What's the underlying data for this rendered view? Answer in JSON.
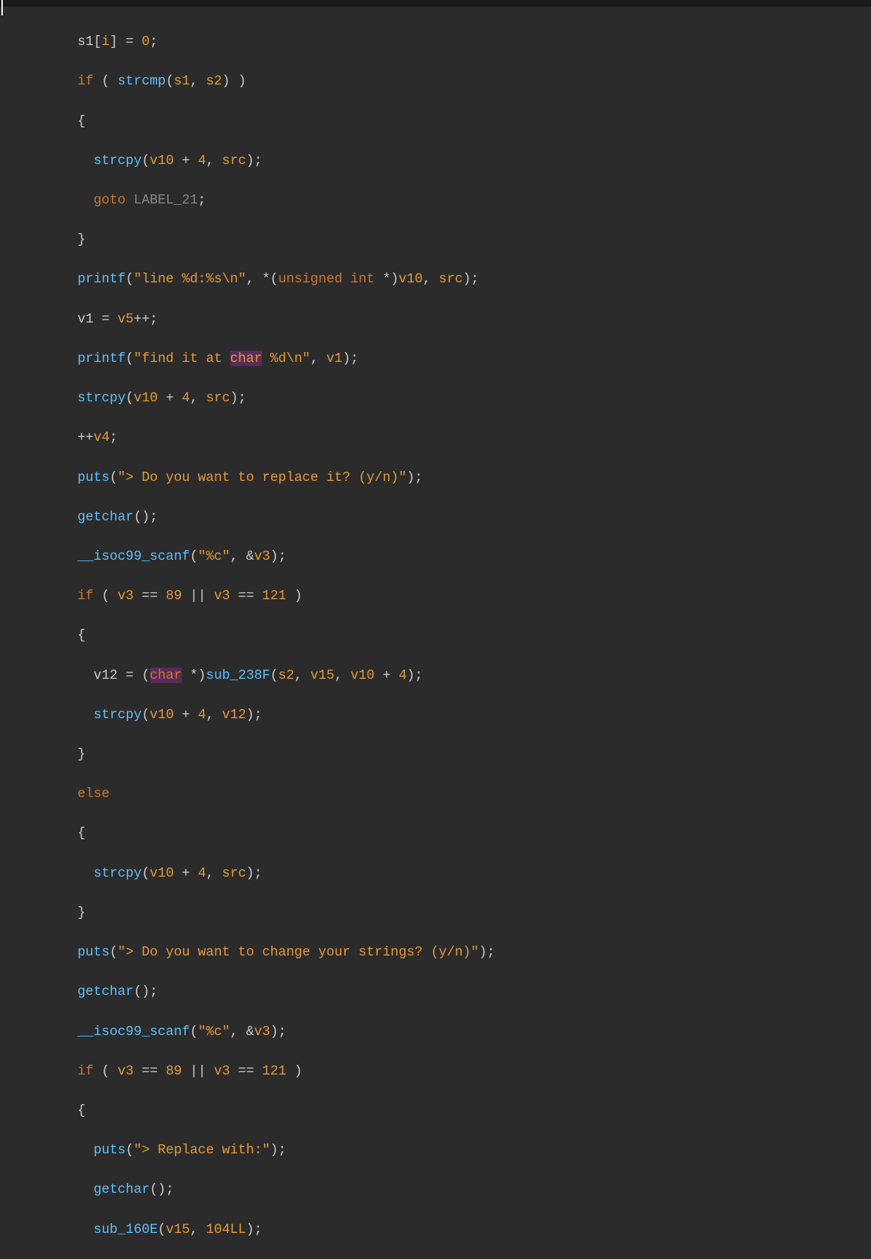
{
  "code": {
    "l1": {
      "a": "s1",
      "b": "[",
      "c": "i",
      "d": "] = ",
      "e": "0",
      "f": ";"
    },
    "l2": {
      "a": "if",
      "b": " ( ",
      "c": "strcmp",
      "d": "(",
      "e": "s1",
      "f": ", ",
      "g": "s2",
      "h": ") )"
    },
    "l3": {
      "a": "{"
    },
    "l4": {
      "a": "strcpy",
      "b": "(",
      "c": "v10",
      "d": " + ",
      "e": "4",
      "f": ", ",
      "g": "src",
      "h": ");"
    },
    "l5": {
      "a": "goto",
      "b": " ",
      "c": "LABEL_21",
      "d": ";"
    },
    "l6": {
      "a": "}"
    },
    "l7": {
      "a": "printf",
      "b": "(",
      "c": "\"line %d:%s\\n\"",
      "d": ", *(",
      "e": "unsigned",
      "f": " ",
      "g": "int",
      "h": " *)",
      "i": "v10",
      "j": ", ",
      "k": "src",
      "l": ");"
    },
    "l8": {
      "a": "v1",
      "b": " = ",
      "c": "v5",
      "d": "++;"
    },
    "l9": {
      "a": "printf",
      "b": "(",
      "c": "\"find it at ",
      "d": "char",
      "e": " %d\\n\"",
      "f": ", ",
      "g": "v1",
      "h": ");"
    },
    "l10": {
      "a": "strcpy",
      "b": "(",
      "c": "v10",
      "d": " + ",
      "e": "4",
      "f": ", ",
      "g": "src",
      "h": ");"
    },
    "l11": {
      "a": "++",
      "b": "v4",
      "c": ";"
    },
    "l12": {
      "a": "puts",
      "b": "(",
      "c": "\"> Do you want to replace it? (y/n)\"",
      "d": ");"
    },
    "l13": {
      "a": "getchar",
      "b": "();"
    },
    "l14": {
      "a": "__isoc99_scanf",
      "b": "(",
      "c": "\"%c\"",
      "d": ", &",
      "e": "v3",
      "f": ");"
    },
    "l15": {
      "a": "if",
      "b": " ( ",
      "c": "v3",
      "d": " == ",
      "e": "89",
      "f": " || ",
      "g": "v3",
      "h": " == ",
      "i": "121",
      "j": " )"
    },
    "l16": {
      "a": "{"
    },
    "l17": {
      "a": "v12",
      "b": " = (",
      "c": "char",
      "d": " *)",
      "e": "sub_238F",
      "f": "(",
      "g": "s2",
      "h": ", ",
      "i": "v15",
      "j": ", ",
      "k": "v10",
      "l": " + ",
      "m": "4",
      "n": ");"
    },
    "l18": {
      "a": "strcpy",
      "b": "(",
      "c": "v10",
      "d": " + ",
      "e": "4",
      "f": ", ",
      "g": "v12",
      "h": ");"
    },
    "l19": {
      "a": "}"
    },
    "l20": {
      "a": "else"
    },
    "l21": {
      "a": "{"
    },
    "l22": {
      "a": "strcpy",
      "b": "(",
      "c": "v10",
      "d": " + ",
      "e": "4",
      "f": ", ",
      "g": "src",
      "h": ");"
    },
    "l23": {
      "a": "}"
    },
    "l24": {
      "a": "puts",
      "b": "(",
      "c": "\"> Do you want to change your strings? (y/n)\"",
      "d": ");"
    },
    "l25": {
      "a": "getchar",
      "b": "();"
    },
    "l26": {
      "a": "__isoc99_scanf",
      "b": "(",
      "c": "\"%c\"",
      "d": ", &",
      "e": "v3",
      "f": ");"
    },
    "l27": {
      "a": "if",
      "b": " ( ",
      "c": "v3",
      "d": " == ",
      "e": "89",
      "f": " || ",
      "g": "v3",
      "h": " == ",
      "i": "121",
      "j": " )"
    },
    "l28": {
      "a": "{"
    },
    "l29": {
      "a": "puts",
      "b": "(",
      "c": "\"> Replace with:\"",
      "d": ");"
    },
    "l30": {
      "a": "getchar",
      "b": "();"
    },
    "l31": {
      "a": "sub_160E",
      "b": "(",
      "c": "v15",
      "d": ", ",
      "e": "104LL",
      "f": ");"
    }
  }
}
